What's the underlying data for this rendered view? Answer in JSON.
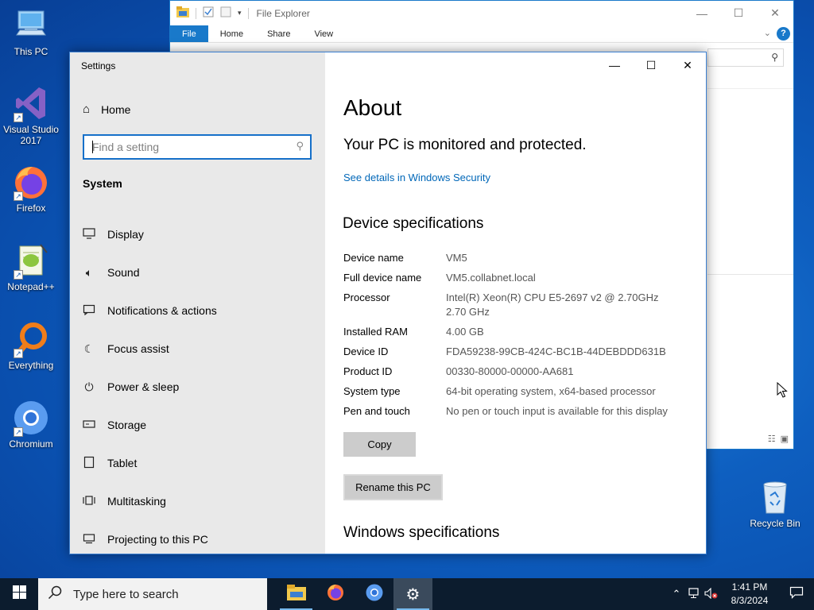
{
  "desktop": {
    "icons": [
      {
        "label": "This PC",
        "icon": "computer-icon"
      },
      {
        "label": "Visual Studio 2017",
        "icon": "visual-studio-icon"
      },
      {
        "label": "Firefox",
        "icon": "firefox-icon"
      },
      {
        "label": "Notepad++",
        "icon": "notepadpp-icon"
      },
      {
        "label": "Everything",
        "icon": "search-magnifier-icon"
      },
      {
        "label": "Chromium",
        "icon": "chromium-icon"
      }
    ],
    "recycle_bin": "Recycle Bin"
  },
  "file_explorer": {
    "title": "File Explorer",
    "tabs": [
      "File",
      "Home",
      "Share",
      "View"
    ],
    "help": "?"
  },
  "settings": {
    "window_title": "Settings",
    "home_label": "Home",
    "search_placeholder": "Find a setting",
    "section_label": "System",
    "nav_items": [
      {
        "label": "Display",
        "icon": "monitor-icon"
      },
      {
        "label": "Sound",
        "icon": "speaker-icon"
      },
      {
        "label": "Notifications & actions",
        "icon": "notification-icon"
      },
      {
        "label": "Focus assist",
        "icon": "moon-icon"
      },
      {
        "label": "Power & sleep",
        "icon": "power-icon"
      },
      {
        "label": "Storage",
        "icon": "storage-icon"
      },
      {
        "label": "Tablet",
        "icon": "tablet-icon"
      },
      {
        "label": "Multitasking",
        "icon": "multitasking-icon"
      },
      {
        "label": "Projecting to this PC",
        "icon": "projecting-icon"
      }
    ],
    "page_title": "About",
    "protection_status": "Your PC is monitored and protected.",
    "security_link": "See details in Windows Security",
    "device_specs_heading": "Device specifications",
    "specs": [
      {
        "key": "Device name",
        "value": "VM5"
      },
      {
        "key": "Full device name",
        "value": "VM5.collabnet.local"
      },
      {
        "key": "Processor",
        "value": "Intel(R) Xeon(R) CPU E5-2697 v2 @ 2.70GHz",
        "value2": "2.70 GHz"
      },
      {
        "key": "Installed RAM",
        "value": "4.00 GB"
      },
      {
        "key": "Device ID",
        "value": "FDA59238-99CB-424C-BC1B-44DEBDDD631B"
      },
      {
        "key": "Product ID",
        "value": "00330-80000-00000-AA681"
      },
      {
        "key": "System type",
        "value": "64-bit operating system, x64-based processor"
      },
      {
        "key": "Pen and touch",
        "value": "No pen or touch input is available for this display"
      }
    ],
    "copy_button": "Copy",
    "rename_button": "Rename this PC",
    "windows_specs_heading": "Windows specifications"
  },
  "taskbar": {
    "search_placeholder": "Type here to search",
    "apps": [
      "file-explorer-icon",
      "firefox-icon",
      "chromium-icon",
      "settings-gear-icon"
    ],
    "active_app": "settings-gear-icon",
    "time": "1:41 PM",
    "date": "8/3/2024"
  },
  "colors": {
    "accent": "#0067b8",
    "desktop_bg": "#0e5fc0",
    "taskbar_bg": "#0c1c2e"
  }
}
